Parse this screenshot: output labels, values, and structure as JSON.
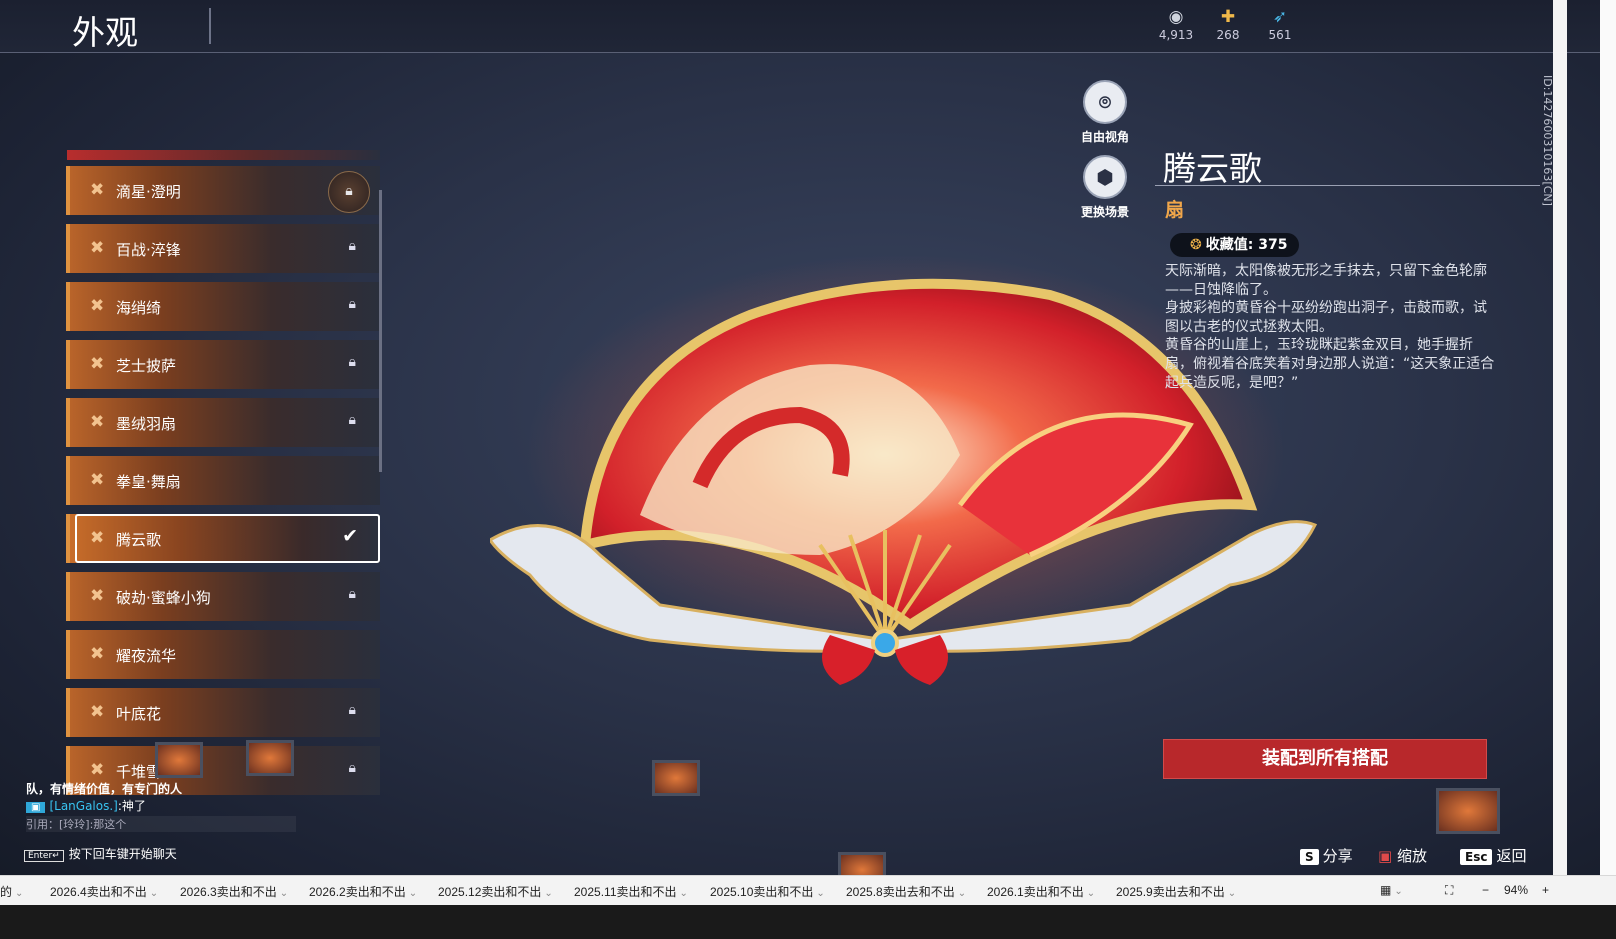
{
  "header": {
    "title": "外观"
  },
  "currency": [
    {
      "icon": "silver-icon",
      "value": "4,913"
    },
    {
      "icon": "ticket-icon",
      "value": "268"
    },
    {
      "icon": "feather-icon",
      "value": "561"
    }
  ],
  "view_buttons": {
    "free_view": "自由视角",
    "change_scene": "更换场景"
  },
  "list": {
    "items": [
      {
        "label": "滴星·澄明",
        "state": "lock-ring"
      },
      {
        "label": "百战·淬锋",
        "state": "lock"
      },
      {
        "label": "海绡绮",
        "state": "lock"
      },
      {
        "label": "芝士披萨",
        "state": "lock"
      },
      {
        "label": "墨绒羽扇",
        "state": "lock"
      },
      {
        "label": "拳皇·舞扇",
        "state": "none"
      },
      {
        "label": "腾云歌",
        "state": "selected"
      },
      {
        "label": "破劫·蜜蜂小狗",
        "state": "lock"
      },
      {
        "label": "耀夜流华",
        "state": "none"
      },
      {
        "label": "叶底花",
        "state": "lock"
      },
      {
        "label": "千堆雪",
        "state": "lock"
      }
    ]
  },
  "detail": {
    "name": "腾云歌",
    "type": "扇",
    "collection": "收藏值: 375",
    "desc1": "天际渐暗，太阳像被无形之手抹去，只留下金色轮廓——日蚀降临了。",
    "desc2": "身披彩袍的黄昏谷十巫纷纷跑出洞子，击鼓而歌，试图以古老的仪式拯救太阳。",
    "desc3": "黄昏谷的山崖上，玉玲珑眯起紫金双目，她手握折扇，俯视着谷底笑着对身边那人说道：“这天象正适合起兵造反呢，是吧？”",
    "equip_button": "装配到所有搭配"
  },
  "hints": {
    "share_key": "S",
    "share": "分享",
    "zoom": "缩放",
    "esc_key": "Esc",
    "back": "返回"
  },
  "chat": {
    "line1": "队，有情绪价值，有专门的人",
    "line2_name": "[LanGalos.]",
    "line2_text": ":神了",
    "line3": "引用：[玲玲]:那这个",
    "enter_key": "Enter↵",
    "enter_hint": "按下回车键开始聊天"
  },
  "version_id": "ID:1427600310163[CN]",
  "sheet_tabs": [
    "的",
    "2026.4卖出和不出",
    "2026.3卖出和不出",
    "2026.2卖出和不出",
    "2025.12卖出和不出",
    "2025.11卖出和不出",
    "2025.10卖出和不出",
    "2025.8卖出去和不出",
    "2026.1卖出和不出",
    "2025.9卖出去和不出"
  ],
  "zoom_level": "94%"
}
